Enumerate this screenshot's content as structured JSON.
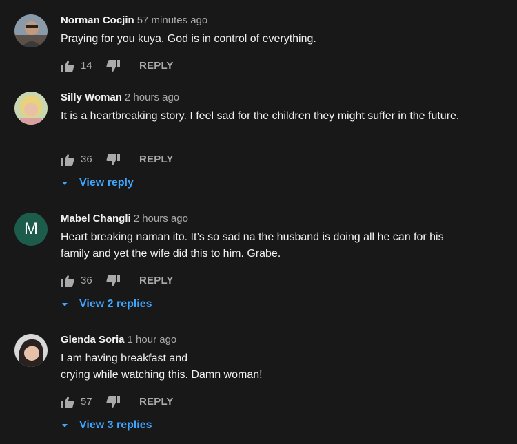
{
  "comments": [
    {
      "author": "Norman Cocjin",
      "time": "57 minutes ago",
      "text": "Praying for you kuya, God is in control of everything.",
      "likes": "14",
      "reply_label": "REPLY",
      "avatar_icon": "photo-avatar"
    },
    {
      "author": "Silly Woman",
      "time": "2 hours ago",
      "text": "It is a heartbreaking story.  I feel sad for the children they might suffer in the future.",
      "likes": "36",
      "reply_label": "REPLY",
      "view_replies": "View reply",
      "avatar_icon": "photo-avatar"
    },
    {
      "author": "Mabel Changli",
      "time": "2 hours ago",
      "text": "Heart breaking naman ito.  It’s so sad na the husband is doing all he can for his family and yet the wife did this to him.  Grabe.",
      "likes": "36",
      "reply_label": "REPLY",
      "view_replies": "View 2 replies",
      "avatar_letter": "M",
      "avatar_color": "#1d5c4b"
    },
    {
      "author": "Glenda Soria",
      "time": "1 hour ago",
      "text_line1": "I am having breakfast and",
      "text_line2": "crying while watching this. Damn woman!",
      "likes": "57",
      "reply_label": "REPLY",
      "view_replies": "View 3 replies",
      "avatar_icon": "photo-avatar"
    }
  ],
  "colors": {
    "background": "#181818",
    "primary_text": "#f1f1f1",
    "secondary_text": "#aaaaaa",
    "link": "#3ea6ff"
  }
}
